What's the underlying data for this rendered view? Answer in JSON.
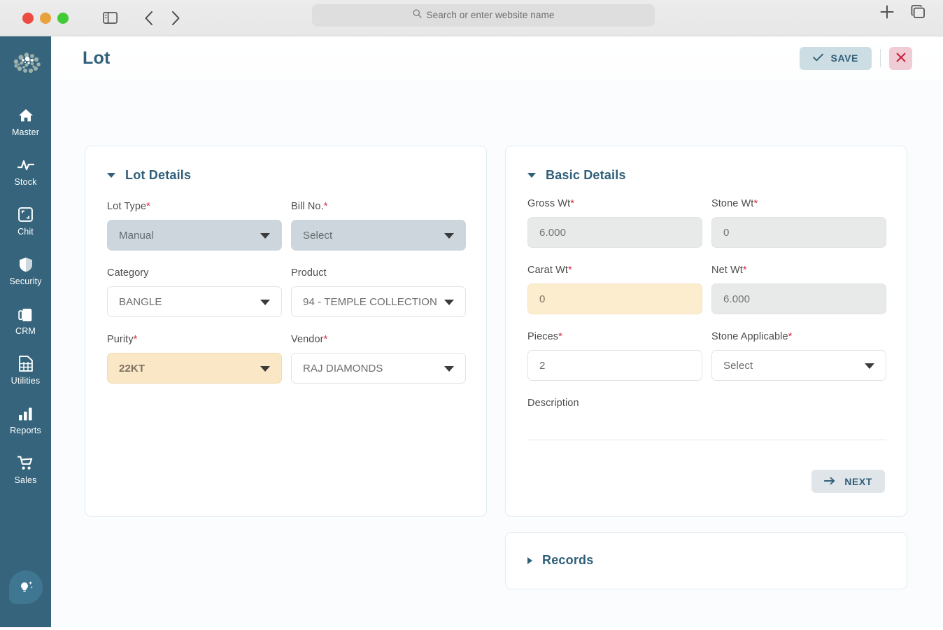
{
  "browser": {
    "search_placeholder": "Search or enter website name",
    "icons": {
      "sidebar_toggle": "sidebar-toggle-icon",
      "back": "chevron-left-icon",
      "forward": "chevron-right-icon",
      "search": "search-icon",
      "new_tab": "plus-icon",
      "tab_overview": "tab-overview-icon"
    }
  },
  "app": {
    "accent": "#2f5f79",
    "rail_bg": "#35647c",
    "required_color": "#d32b47",
    "highlight_color": "#fae7c6"
  },
  "sidebar": {
    "logo_name": "app-logo",
    "items": [
      {
        "label": "Master",
        "icon": "home-icon"
      },
      {
        "label": "Stock",
        "icon": "activity-pulse-icon"
      },
      {
        "label": "Chit",
        "icon": "expand-frame-icon"
      },
      {
        "label": "Security",
        "icon": "shield-icon"
      },
      {
        "label": "CRM",
        "icon": "contact-card-icon"
      },
      {
        "label": "Utilities",
        "icon": "grid-document-icon"
      },
      {
        "label": "Reports",
        "icon": "bar-chart-icon"
      },
      {
        "label": "Sales",
        "icon": "shopping-cart-icon"
      }
    ],
    "fab": {
      "icon": "lightbulb-idea-icon"
    }
  },
  "header": {
    "title": "Lot",
    "save_label": "SAVE",
    "save_icon": "check-icon",
    "close_icon": "close-x-icon"
  },
  "lot_details": {
    "title": "Lot Details",
    "collapsed": false,
    "fields": [
      {
        "label": "Lot Type",
        "required": true,
        "value": "Manual",
        "type": "select",
        "state": "disabled-blue"
      },
      {
        "label": "Bill No.",
        "required": true,
        "value": "Select",
        "type": "select",
        "state": "disabled-blue"
      },
      {
        "label": "Category",
        "required": false,
        "value": "BANGLE",
        "type": "select",
        "state": "normal"
      },
      {
        "label": "Product",
        "required": false,
        "value": "94 - TEMPLE COLLECTION",
        "type": "select",
        "state": "normal"
      },
      {
        "label": "Purity",
        "required": true,
        "value": "22KT",
        "type": "select",
        "state": "highlight"
      },
      {
        "label": "Vendor",
        "required": true,
        "value": "RAJ DIAMONDS",
        "type": "select",
        "state": "normal"
      }
    ]
  },
  "basic_details": {
    "title": "Basic Details",
    "collapsed": false,
    "fields": [
      {
        "label": "Gross Wt",
        "required": true,
        "value": "6.000",
        "type": "text",
        "state": "disabled-grey"
      },
      {
        "label": "Stone Wt",
        "required": true,
        "value": "0",
        "type": "text",
        "state": "disabled-grey"
      },
      {
        "label": "Carat Wt",
        "required": true,
        "value": "0",
        "type": "text",
        "state": "highlight-soft"
      },
      {
        "label": "Net Wt",
        "required": true,
        "value": "6.000",
        "type": "text",
        "state": "disabled-grey"
      },
      {
        "label": "Pieces",
        "required": true,
        "value": "2",
        "type": "text",
        "state": "normal"
      },
      {
        "label": "Stone Applicable",
        "required": true,
        "value": "Select",
        "type": "select",
        "state": "normal"
      }
    ],
    "description_label": "Description",
    "description_value": "",
    "next_label": "NEXT",
    "next_icon": "arrow-right-icon"
  },
  "records": {
    "title": "Records",
    "collapsed": true
  }
}
